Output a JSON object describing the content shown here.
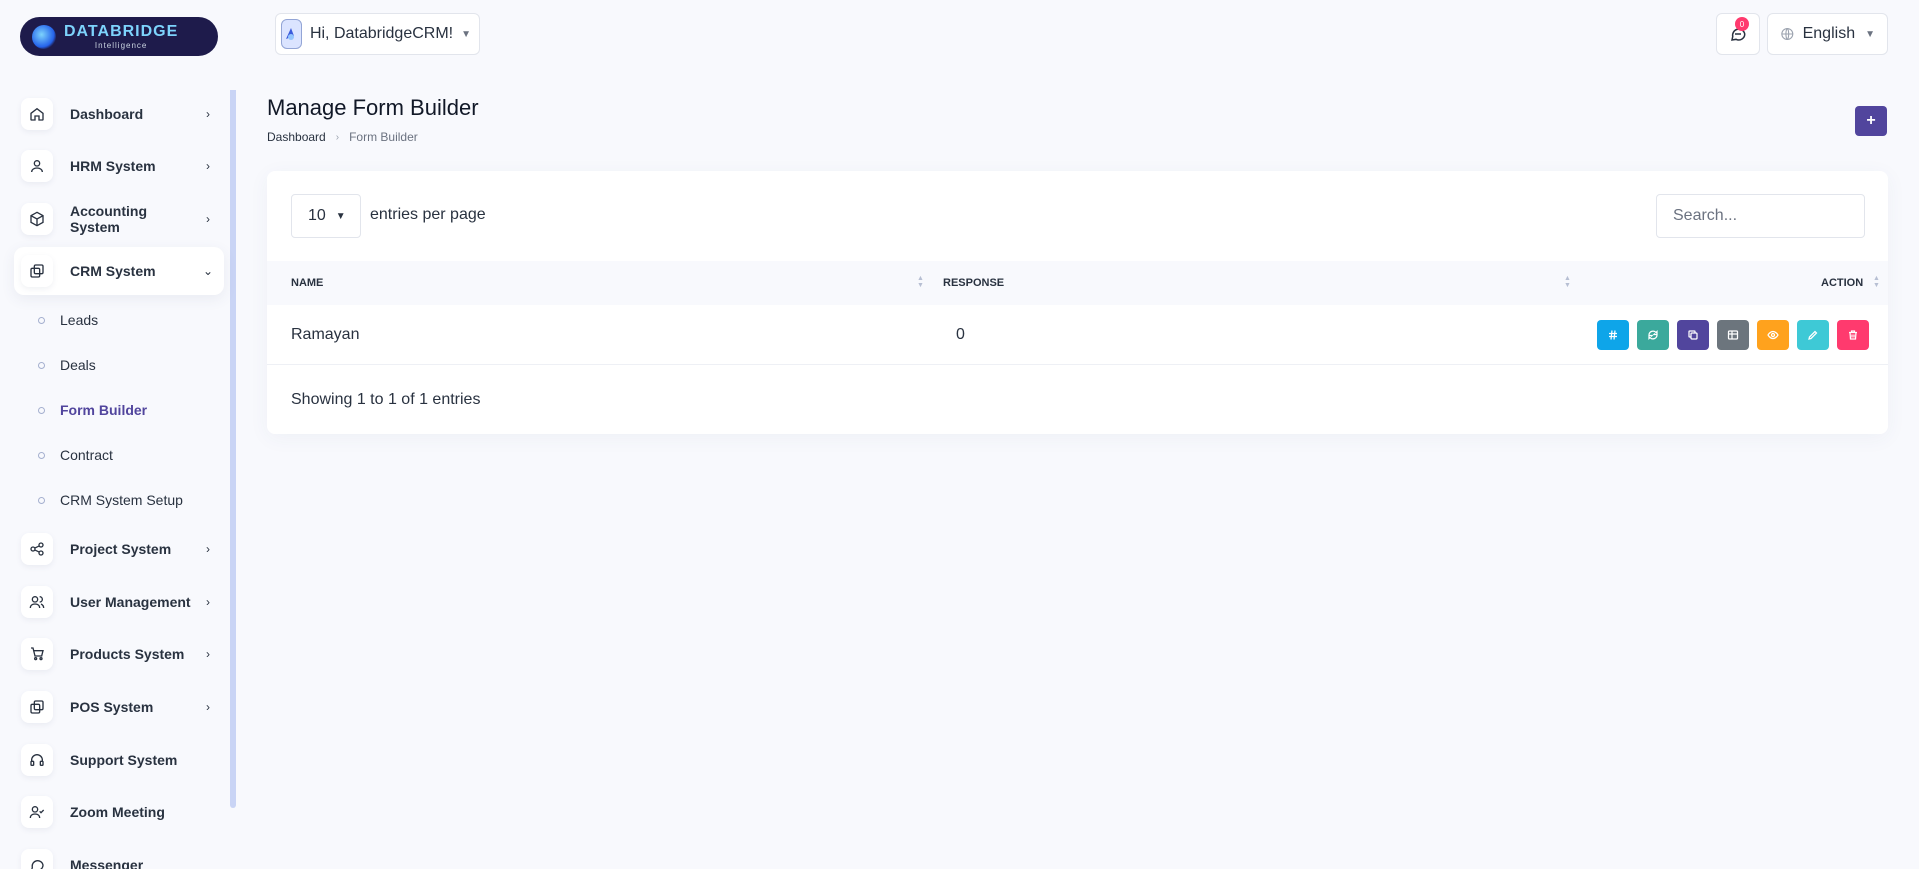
{
  "brand": {
    "name": "DATABRIDGE",
    "tagline": "Intelligence"
  },
  "header": {
    "greeting": "Hi, DatabridgeCRM!",
    "notification_count": "0",
    "language": "English"
  },
  "sidebar": {
    "items": [
      {
        "label": "Dashboard",
        "icon": "home-icon"
      },
      {
        "label": "HRM System",
        "icon": "user-icon"
      },
      {
        "label": "Accounting System",
        "icon": "box-icon"
      },
      {
        "label": "CRM System",
        "icon": "layers-icon",
        "expanded": true
      },
      {
        "label": "Project System",
        "icon": "share-icon"
      },
      {
        "label": "User Management",
        "icon": "users-icon"
      },
      {
        "label": "Products System",
        "icon": "cart-icon"
      },
      {
        "label": "POS System",
        "icon": "layers-icon"
      },
      {
        "label": "Support System",
        "icon": "headset-icon"
      },
      {
        "label": "Zoom Meeting",
        "icon": "user-check-icon"
      },
      {
        "label": "Messenger",
        "icon": "message-icon"
      }
    ],
    "crm_sub": [
      "Leads",
      "Deals",
      "Form Builder",
      "Contract",
      "CRM System Setup"
    ]
  },
  "page": {
    "title": "Manage Form Builder",
    "breadcrumb": {
      "home": "Dashboard",
      "current": "Form Builder"
    },
    "add_label": "+"
  },
  "table": {
    "per_page": "10",
    "per_page_label": "entries per page",
    "search_placeholder": "Search...",
    "columns": [
      "NAME",
      "RESPONSE",
      "ACTION"
    ],
    "rows": [
      {
        "name": "Ramayan",
        "response": "0"
      }
    ],
    "info": "Showing 1 to 1 of 1 entries"
  },
  "action_colors": [
    "#0ea5e9",
    "#3ba99c",
    "#51459d",
    "#6c757d",
    "#ffa21d",
    "#3ec9d6",
    "#ff3a6e"
  ]
}
